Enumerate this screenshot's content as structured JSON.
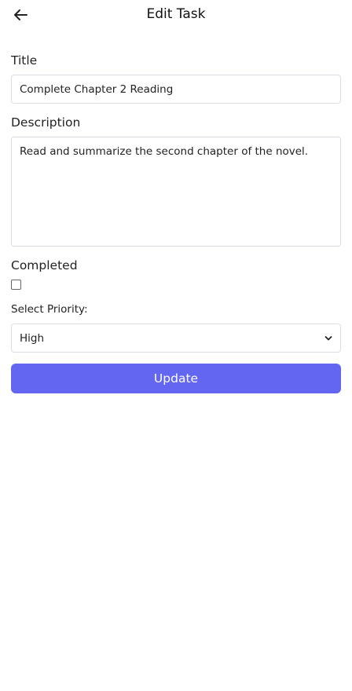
{
  "header": {
    "title": "Edit Task",
    "back_icon": "arrow-left-icon"
  },
  "form": {
    "title_label": "Title",
    "title_value": "Complete Chapter 2 Reading",
    "description_label": "Description",
    "description_value": "Read and summarize the second chapter of the novel.",
    "completed_label": "Completed",
    "completed_checked": false,
    "priority_label": "Select Priority:",
    "priority_value": "High",
    "update_label": "Update"
  },
  "colors": {
    "accent": "#6366f1",
    "border": "#d9dde3"
  }
}
